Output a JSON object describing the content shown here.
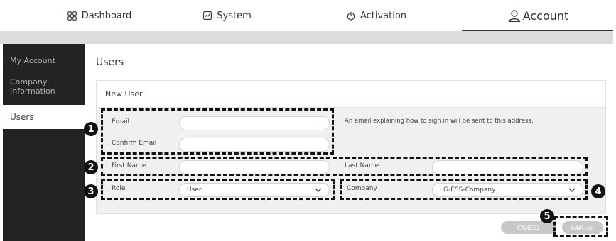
{
  "nav": {
    "tabs": [
      {
        "label": "Dashboard",
        "icon": "dashboard-grid-icon"
      },
      {
        "label": "System",
        "icon": "system-chart-icon"
      },
      {
        "label": "Activation",
        "icon": "power-icon"
      },
      {
        "label": "Account",
        "icon": "user-account-icon"
      }
    ],
    "active_tab": "Account"
  },
  "sidebar": {
    "items": [
      {
        "label": "My Account"
      },
      {
        "label": "Company Information"
      },
      {
        "label": "Users"
      }
    ],
    "active_item": "Users"
  },
  "main": {
    "title": "Users",
    "panel_title": "New User",
    "fields": {
      "email_label": "Email",
      "email_value": "",
      "email_hint": "An email explaining how to sign in will be sent to this address.",
      "confirm_email_label": "Confirm Email",
      "confirm_email_value": "",
      "first_name_label": "First Name",
      "first_name_value": "",
      "last_name_label": "Last Name",
      "last_name_value": "",
      "role_label": "Role",
      "role_value": "User",
      "company_label": "Company",
      "company_value": "LG-ESS-Company"
    },
    "buttons": {
      "cancel_label": "CANCEL",
      "add_user_label": "AddUser"
    }
  },
  "callouts": [
    "1",
    "2",
    "3",
    "4",
    "5"
  ],
  "colors": {
    "sidebar_bg": "#232323",
    "panel_bg": "#f0f0f0",
    "button_bg": "#c8c8c8",
    "callout": "#111111"
  }
}
